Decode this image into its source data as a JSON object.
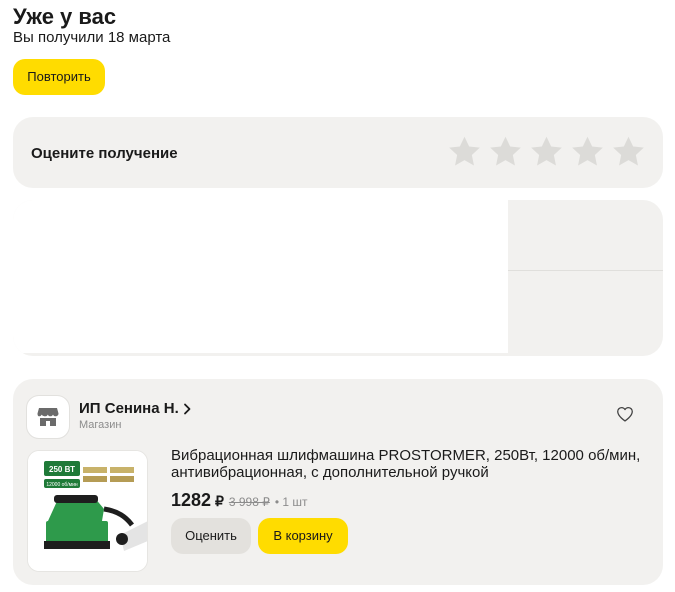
{
  "order": {
    "status_title": "Уже у вас",
    "received_text": "Вы получили 18 марта",
    "repeat_label": "Повторить"
  },
  "rating": {
    "label": "Оцените получение",
    "stars_total": 5,
    "stars_selected": 0,
    "star_color": "#dcdbd8"
  },
  "shop": {
    "name": "ИП Сенина Н.",
    "type": "Магазин"
  },
  "product": {
    "title": "Вибрационная шлифмашина PROSTORMER, 250Вт, 12000 об/мин, антивибрационная, с дополнительной ручкой",
    "price": "1282",
    "currency": "₽",
    "old_price": "3 998 ₽",
    "quantity": "• 1 шт",
    "image_badge": "250 ВТ",
    "image_caption": "12000 об/мин",
    "rate_label": "Оценить",
    "cart_label": "В корзину"
  },
  "colors": {
    "accent": "#ffdc00",
    "card_bg": "#f2f1ef",
    "muted_text": "#8c8c8c",
    "tool_green": "#2e9a4b"
  }
}
